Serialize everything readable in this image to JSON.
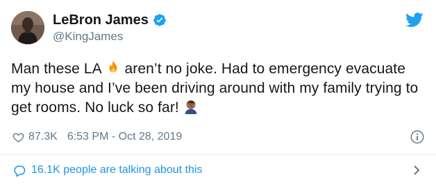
{
  "colors": {
    "accent": "#1da1f2",
    "link": "#1b95e0",
    "muted": "#657786",
    "text": "#14171a",
    "divider": "#e6ecf0"
  },
  "user": {
    "display_name": "LeBron James",
    "handle": "@KingJames",
    "verified_icon": "verified-badge-icon",
    "avatar": "avatar"
  },
  "tweet": {
    "line1_a": "Man these LA ",
    "line1_b": " aren’t no joke. Had to emergency evacuate",
    "line2": "my house and I’ve been driving around with my family trying to",
    "line3": "get rooms. No luck so far! ",
    "emoji_1": "fire-emoji",
    "emoji_2": "facepalm-emoji"
  },
  "meta": {
    "likes": "87.3K",
    "timestamp": "6:53 PM - Oct 28, 2019"
  },
  "footer": {
    "talking": "16.1K people are talking about this"
  },
  "icons": {
    "logo": "twitter-bird-icon",
    "like": "heart-icon",
    "info": "info-icon",
    "reply": "reply-bubble-icon",
    "chevron": "chevron-right-icon"
  }
}
